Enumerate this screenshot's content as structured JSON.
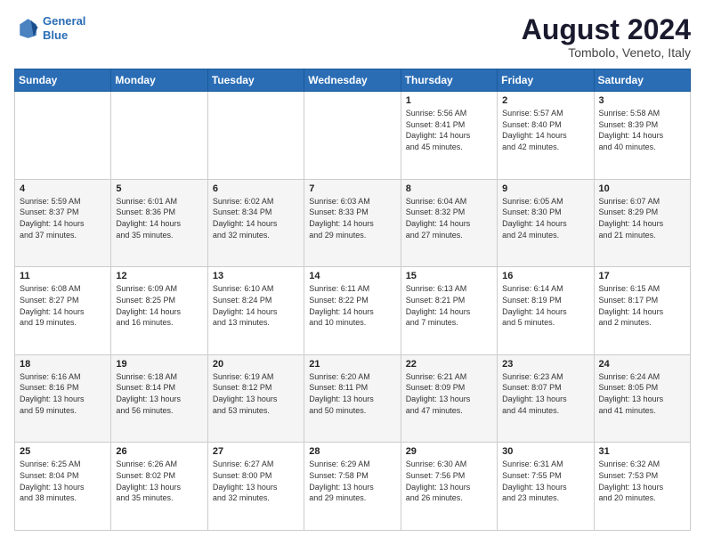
{
  "header": {
    "logo_line1": "General",
    "logo_line2": "Blue",
    "main_title": "August 2024",
    "subtitle": "Tombolo, Veneto, Italy"
  },
  "weekdays": [
    "Sunday",
    "Monday",
    "Tuesday",
    "Wednesday",
    "Thursday",
    "Friday",
    "Saturday"
  ],
  "weeks": [
    [
      {
        "day": "",
        "info": ""
      },
      {
        "day": "",
        "info": ""
      },
      {
        "day": "",
        "info": ""
      },
      {
        "day": "",
        "info": ""
      },
      {
        "day": "1",
        "info": "Sunrise: 5:56 AM\nSunset: 8:41 PM\nDaylight: 14 hours\nand 45 minutes."
      },
      {
        "day": "2",
        "info": "Sunrise: 5:57 AM\nSunset: 8:40 PM\nDaylight: 14 hours\nand 42 minutes."
      },
      {
        "day": "3",
        "info": "Sunrise: 5:58 AM\nSunset: 8:39 PM\nDaylight: 14 hours\nand 40 minutes."
      }
    ],
    [
      {
        "day": "4",
        "info": "Sunrise: 5:59 AM\nSunset: 8:37 PM\nDaylight: 14 hours\nand 37 minutes."
      },
      {
        "day": "5",
        "info": "Sunrise: 6:01 AM\nSunset: 8:36 PM\nDaylight: 14 hours\nand 35 minutes."
      },
      {
        "day": "6",
        "info": "Sunrise: 6:02 AM\nSunset: 8:34 PM\nDaylight: 14 hours\nand 32 minutes."
      },
      {
        "day": "7",
        "info": "Sunrise: 6:03 AM\nSunset: 8:33 PM\nDaylight: 14 hours\nand 29 minutes."
      },
      {
        "day": "8",
        "info": "Sunrise: 6:04 AM\nSunset: 8:32 PM\nDaylight: 14 hours\nand 27 minutes."
      },
      {
        "day": "9",
        "info": "Sunrise: 6:05 AM\nSunset: 8:30 PM\nDaylight: 14 hours\nand 24 minutes."
      },
      {
        "day": "10",
        "info": "Sunrise: 6:07 AM\nSunset: 8:29 PM\nDaylight: 14 hours\nand 21 minutes."
      }
    ],
    [
      {
        "day": "11",
        "info": "Sunrise: 6:08 AM\nSunset: 8:27 PM\nDaylight: 14 hours\nand 19 minutes."
      },
      {
        "day": "12",
        "info": "Sunrise: 6:09 AM\nSunset: 8:25 PM\nDaylight: 14 hours\nand 16 minutes."
      },
      {
        "day": "13",
        "info": "Sunrise: 6:10 AM\nSunset: 8:24 PM\nDaylight: 14 hours\nand 13 minutes."
      },
      {
        "day": "14",
        "info": "Sunrise: 6:11 AM\nSunset: 8:22 PM\nDaylight: 14 hours\nand 10 minutes."
      },
      {
        "day": "15",
        "info": "Sunrise: 6:13 AM\nSunset: 8:21 PM\nDaylight: 14 hours\nand 7 minutes."
      },
      {
        "day": "16",
        "info": "Sunrise: 6:14 AM\nSunset: 8:19 PM\nDaylight: 14 hours\nand 5 minutes."
      },
      {
        "day": "17",
        "info": "Sunrise: 6:15 AM\nSunset: 8:17 PM\nDaylight: 14 hours\nand 2 minutes."
      }
    ],
    [
      {
        "day": "18",
        "info": "Sunrise: 6:16 AM\nSunset: 8:16 PM\nDaylight: 13 hours\nand 59 minutes."
      },
      {
        "day": "19",
        "info": "Sunrise: 6:18 AM\nSunset: 8:14 PM\nDaylight: 13 hours\nand 56 minutes."
      },
      {
        "day": "20",
        "info": "Sunrise: 6:19 AM\nSunset: 8:12 PM\nDaylight: 13 hours\nand 53 minutes."
      },
      {
        "day": "21",
        "info": "Sunrise: 6:20 AM\nSunset: 8:11 PM\nDaylight: 13 hours\nand 50 minutes."
      },
      {
        "day": "22",
        "info": "Sunrise: 6:21 AM\nSunset: 8:09 PM\nDaylight: 13 hours\nand 47 minutes."
      },
      {
        "day": "23",
        "info": "Sunrise: 6:23 AM\nSunset: 8:07 PM\nDaylight: 13 hours\nand 44 minutes."
      },
      {
        "day": "24",
        "info": "Sunrise: 6:24 AM\nSunset: 8:05 PM\nDaylight: 13 hours\nand 41 minutes."
      }
    ],
    [
      {
        "day": "25",
        "info": "Sunrise: 6:25 AM\nSunset: 8:04 PM\nDaylight: 13 hours\nand 38 minutes."
      },
      {
        "day": "26",
        "info": "Sunrise: 6:26 AM\nSunset: 8:02 PM\nDaylight: 13 hours\nand 35 minutes."
      },
      {
        "day": "27",
        "info": "Sunrise: 6:27 AM\nSunset: 8:00 PM\nDaylight: 13 hours\nand 32 minutes."
      },
      {
        "day": "28",
        "info": "Sunrise: 6:29 AM\nSunset: 7:58 PM\nDaylight: 13 hours\nand 29 minutes."
      },
      {
        "day": "29",
        "info": "Sunrise: 6:30 AM\nSunset: 7:56 PM\nDaylight: 13 hours\nand 26 minutes."
      },
      {
        "day": "30",
        "info": "Sunrise: 6:31 AM\nSunset: 7:55 PM\nDaylight: 13 hours\nand 23 minutes."
      },
      {
        "day": "31",
        "info": "Sunrise: 6:32 AM\nSunset: 7:53 PM\nDaylight: 13 hours\nand 20 minutes."
      }
    ]
  ]
}
